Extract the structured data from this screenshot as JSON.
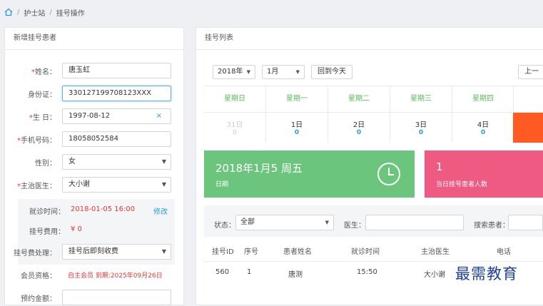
{
  "breadcrumb": {
    "items": [
      "护士站",
      "挂号操作"
    ]
  },
  "left_panel": {
    "title": "新增挂号患者",
    "fields": {
      "name": {
        "label": "姓名：",
        "value": "唐玉虹"
      },
      "id_card": {
        "label": "身份证：",
        "value": "330127199708123XXX"
      },
      "birthday": {
        "label": "生 日：",
        "value": "1997-08-12"
      },
      "phone": {
        "label": "手机号码：",
        "value": "18058052584"
      },
      "gender": {
        "label": "性别：",
        "value": "女"
      },
      "doctor": {
        "label": "主治医生：",
        "value": "大小谢"
      },
      "fee_process": {
        "label": "挂号费处理：",
        "value": "挂号后即刻收费"
      },
      "member": {
        "label": "会员资格：",
        "value": "自主会员 到期:2025年09月26日"
      },
      "next_label": {
        "label": "预约金额："
      }
    },
    "info": {
      "visit_time_label": "就诊时间：",
      "visit_time_value": "2018-01-05 16:00",
      "edit_link": "修改",
      "fee_label": "挂号费用：",
      "fee_value": "¥ 0"
    },
    "clear_icon": "×"
  },
  "right_panel": {
    "title": "挂号列表",
    "controls": {
      "year": "2018年",
      "month": "1月",
      "today_button": "回到今天",
      "prev_button": "上一"
    },
    "weekdays": [
      "星期日",
      "星期一",
      "星期二",
      "星期三",
      "星期四"
    ],
    "days": [
      {
        "day": "31日",
        "count": "0",
        "muted": true
      },
      {
        "day": "1日",
        "count": "0",
        "muted": false
      },
      {
        "day": "2日",
        "count": "0",
        "muted": false
      },
      {
        "day": "3日",
        "count": "0",
        "muted": false
      },
      {
        "day": "4日",
        "count": "0",
        "muted": false
      }
    ],
    "card_date": {
      "title": "2018年1月5 周五",
      "subtitle": "日期",
      "color": "#6cc57c"
    },
    "card_count": {
      "title": "1",
      "subtitle": "当日挂号患者人数",
      "color": "#ee5a82"
    },
    "accent_orange": "#ff5a22",
    "filters": {
      "status_label": "状态：",
      "status_value": "全部",
      "doctor_label": "医生：",
      "search_label": "搜索患者："
    },
    "table": {
      "headers": [
        "挂号ID",
        "序号",
        "患者姓名",
        "就诊时间",
        "主治医生",
        "电话"
      ],
      "rows": [
        {
          "id": "560",
          "seq": "1",
          "name": "唐测",
          "time": "15:50",
          "doctor": "大小谢"
        }
      ]
    }
  },
  "watermark": "最需教育"
}
